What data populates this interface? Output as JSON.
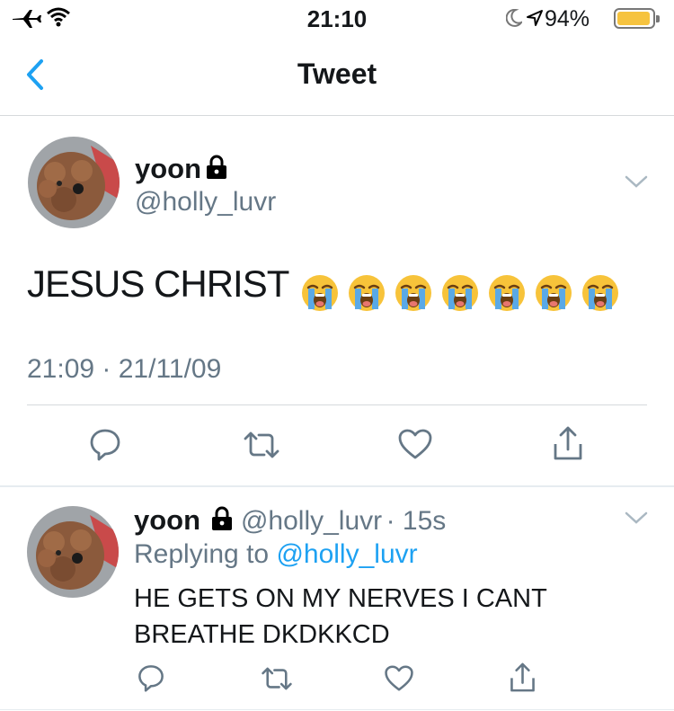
{
  "status_bar": {
    "time": "21:10",
    "battery": "94%",
    "battery_level": 0.94
  },
  "nav": {
    "title": "Tweet"
  },
  "tweet": {
    "author_name": "yoon",
    "author_handle": "@holly_luvr",
    "text": "JESUS CHRIST",
    "emoji": [
      "loudly-crying-face",
      "loudly-crying-face",
      "loudly-crying-face",
      "loudly-crying-face",
      "loudly-crying-face",
      "loudly-crying-face",
      "loudly-crying-face"
    ],
    "timestamp": "21:09 · 21/11/09"
  },
  "reply": {
    "author_name": "yoon",
    "author_handle": "@holly_luvr",
    "age": "· 15s",
    "replying_to_label": "Replying to",
    "replying_to_handle": "@holly_luvr",
    "text_line1": "HE GETS ON MY NERVES I CANT",
    "text_line2": "BREATHE DKDKKCD"
  },
  "colors": {
    "accent": "#1da1f2",
    "secondary_text": "#657786",
    "battery": "#f6c33f"
  }
}
